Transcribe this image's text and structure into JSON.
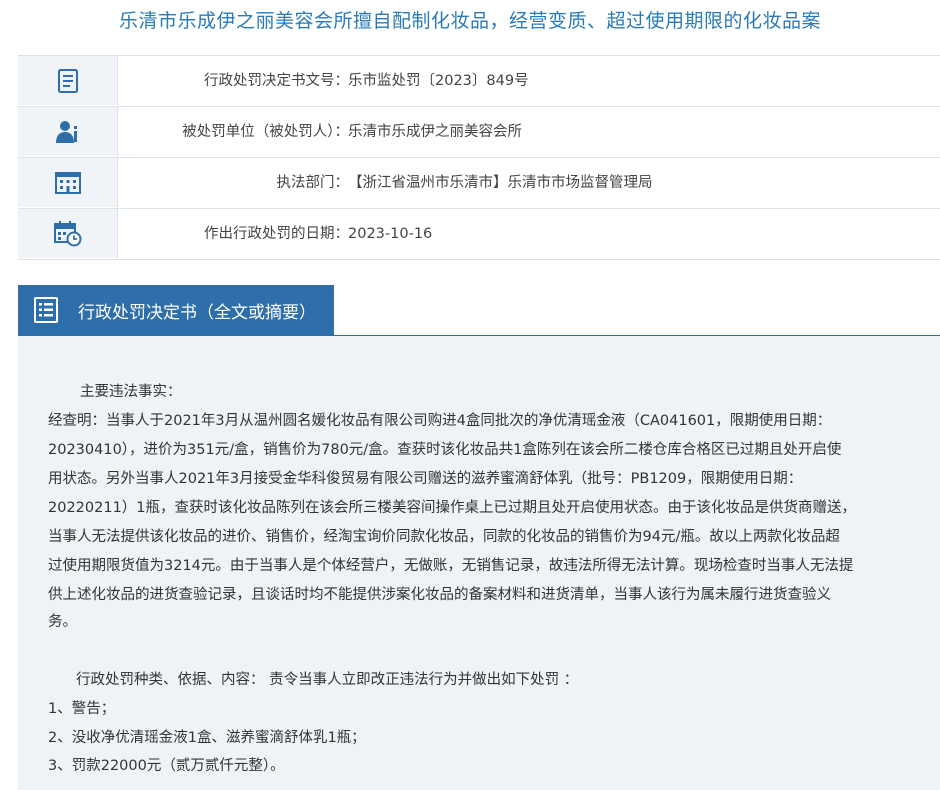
{
  "page_title": "乐清市乐成伊之丽美容会所擅自配制化妆品，经营变质、超过使用期限的化妆品案",
  "info": {
    "decision_no": {
      "label": "行政处罚决定书文号：",
      "value": "乐市监处罚〔2023〕849号",
      "icon": "document-icon"
    },
    "party": {
      "label": "被处罚单位（被处罚人）：",
      "value": "乐清市乐成伊之丽美容会所",
      "icon": "person-icon"
    },
    "department": {
      "label": "执法部门：",
      "value": "【浙江省温州市乐清市】乐清市市场监督管理局",
      "icon": "building-icon"
    },
    "date": {
      "label": "作出行政处罚的日期：",
      "value": "2023-10-16",
      "icon": "calendar-clock-icon"
    }
  },
  "section": {
    "title": "行政处罚决定书（全文或摘要）",
    "icon": "document-list-icon"
  },
  "content": {
    "facts_heading": "主要违法事实：",
    "facts_lines": [
      "经查明：当事人于2021年3月从温州圆名媛化妆品有限公司购进4盒同批次的净优清瑶金液（CA041601，限期使用日期：",
      "20230410），进价为351元/盒，销售价为780元/盒。查获时该化妆品共1盒陈列在该会所二楼仓库合格区已过期且处开启使",
      "用状态。另外当事人2021年3月接受金华科俊贸易有限公司赠送的滋养蜜滴舒体乳（批号：PB1209，限期使用日期：",
      "20220211）1瓶，查获时该化妆品陈列在该会所三楼美容间操作桌上已过期且处开启使用状态。由于该化妆品是供货商赠送，",
      "当事人无法提供该化妆品的进价、销售价，经淘宝询价同款化妆品，同款的化妆品的销售价为94元/瓶。故以上两款化妆品超",
      "过使用期限货值为3214元。由于当事人是个体经营户，无做账，无销售记录，故违法所得无法计算。现场检查时当事人无法提",
      "供上述化妆品的进货查验记录，且谈话时均不能提供涉案化妆品的备案材料和进货清单，当事人该行为属未履行进货查验义",
      "务。"
    ],
    "penalty_heading": "行政处罚种类、依据、内容：  责令当事人立即改正违法行为并做出如下处罚   ：",
    "penalty_items": [
      "1、警告；",
      "2、没收净优清瑶金液1盒、滋养蜜滴舒体乳1瓶；",
      "3、罚款22000元（贰万贰仟元整）。"
    ]
  },
  "colors": {
    "accent": "#2f6fa9",
    "title": "#2a7ab8",
    "content_bg": "#eef3f7",
    "icon_cell_bg": "#f0f4f8"
  }
}
